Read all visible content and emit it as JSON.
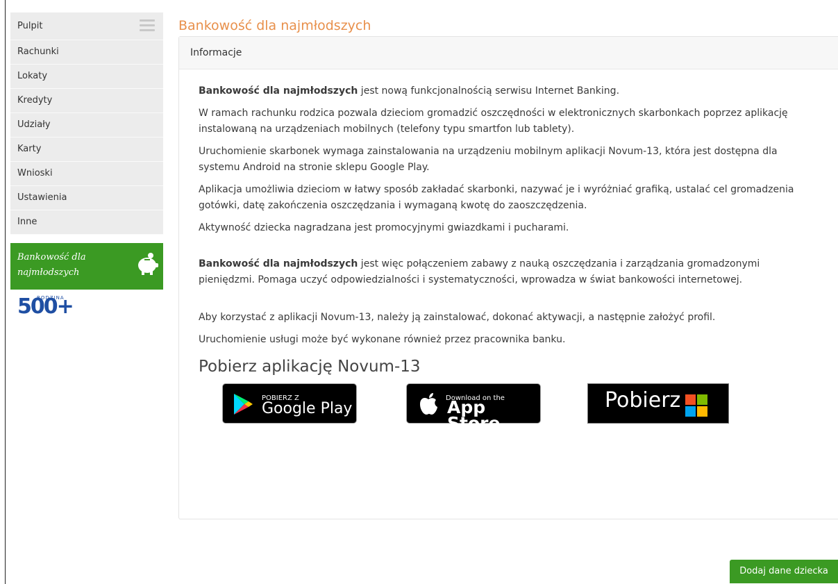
{
  "sidebar": {
    "items": [
      {
        "label": "Pulpit"
      },
      {
        "label": "Rachunki"
      },
      {
        "label": "Lokaty"
      },
      {
        "label": "Kredyty"
      },
      {
        "label": "Udziały"
      },
      {
        "label": "Karty"
      },
      {
        "label": "Wnioski"
      },
      {
        "label": "Ustawienia"
      },
      {
        "label": "Inne"
      }
    ],
    "promo_label": "Bankowość dla najmłodszych",
    "logo_number": "500+",
    "logo_word": "RODZINA"
  },
  "page": {
    "title": "Bankowość dla najmłodszych",
    "panel_header": "Informacje",
    "p1_bold": "Bankowość dla najmłodszych",
    "p1_rest": " jest nową funkcjonalnością serwisu Internet Banking.",
    "p2": "W ramach rachunku rodzica pozwala dzieciom gromadzić oszczędności w elektronicznych skarbonkach poprzez aplikację instalowaną na urządzeniach mobilnych (telefony typu smartfon lub tablety).",
    "p3": "Uruchomienie skarbonek wymaga zainstalowania na urządzeniu mobilnym aplikacji Novum-13, która jest dostępna dla systemu Android na stronie sklepu Google Play.",
    "p4": "Aplikacja umożliwia dzieciom w łatwy sposób zakładać skarbonki, nazywać je i wyróżniać grafiką, ustalać cel gromadzenia gotówki, datę zakończenia oszczędzania i wymaganą kwotę do zaoszczędzenia.",
    "p5": "Aktywność dziecka nagradzana jest promocyjnymi gwiazdkami i pucharami.",
    "p6_bold": "Bankowość dla najmłodszych",
    "p6_rest": " jest więc połączeniem zabawy z nauką oszczędzania i zarządzania gromadzonymi pieniędzmi. Pomaga uczyć odpowiedzialności i systematyczności, wprowadza w świat bankowości internetowej.",
    "p7": "Aby korzystać z aplikacji Novum-13, należy ją zainstalować, dokonać aktywacji, a następnie założyć profil.",
    "p8": "Uruchomienie usługi może być wykonane również przez pracownika banku.",
    "download_title": "Pobierz aplikację Novum-13"
  },
  "badges": {
    "google_top": "POBIERZ Z",
    "google_main": "Google Play",
    "apple_top": "Download on the",
    "apple_main": "App Store",
    "ms_main": "Pobierz"
  },
  "actions": {
    "add_child": "Dodaj dane dziecka"
  },
  "colors": {
    "accent_green": "#3b9a23",
    "title_orange": "#e8904b"
  }
}
